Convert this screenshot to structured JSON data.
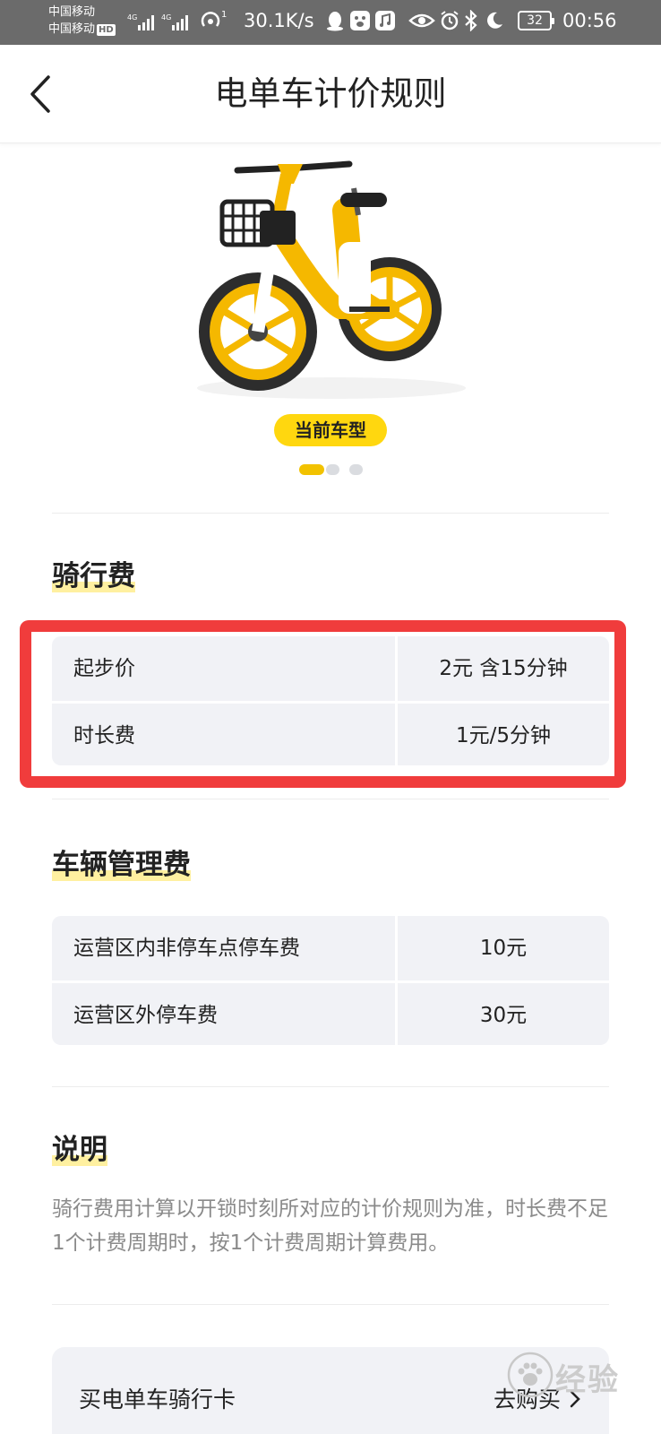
{
  "status_bar": {
    "carrier_1": "中国移动",
    "carrier_2": "中国移动",
    "hd_badge": "HD",
    "net_1": "4G",
    "net_2": "4G",
    "wifi_sup": "1",
    "speed": "30.1K/s",
    "battery": "32",
    "time": "00:56"
  },
  "header": {
    "title": "电单车计价规则"
  },
  "bike": {
    "tag": "当前车型",
    "carousel_count": 3,
    "carousel_active": 0
  },
  "riding_fee": {
    "title": "骑行费",
    "rows": [
      {
        "label": "起步价",
        "value": "2元 含15分钟"
      },
      {
        "label": "时长费",
        "value": "1元/5分钟"
      }
    ]
  },
  "management_fee": {
    "title": "车辆管理费",
    "rows": [
      {
        "label": "运营区内非停车点停车费",
        "value": "10元"
      },
      {
        "label": "运营区外停车费",
        "value": "30元"
      }
    ]
  },
  "notes": {
    "title": "说明",
    "text": "骑行费用计算以开锁时刻所对应的计价规则为准，时长费不足1个计费周期时，按1个计费周期计算费用。"
  },
  "buy_card": {
    "label": "买电单车骑行卡",
    "link": "去购买"
  },
  "watermark": {
    "text": "经验"
  },
  "colors": {
    "accent_yellow": "#ffd70f",
    "highlight_box": "#f03c3c",
    "status_bar": "#6b6b6b"
  }
}
